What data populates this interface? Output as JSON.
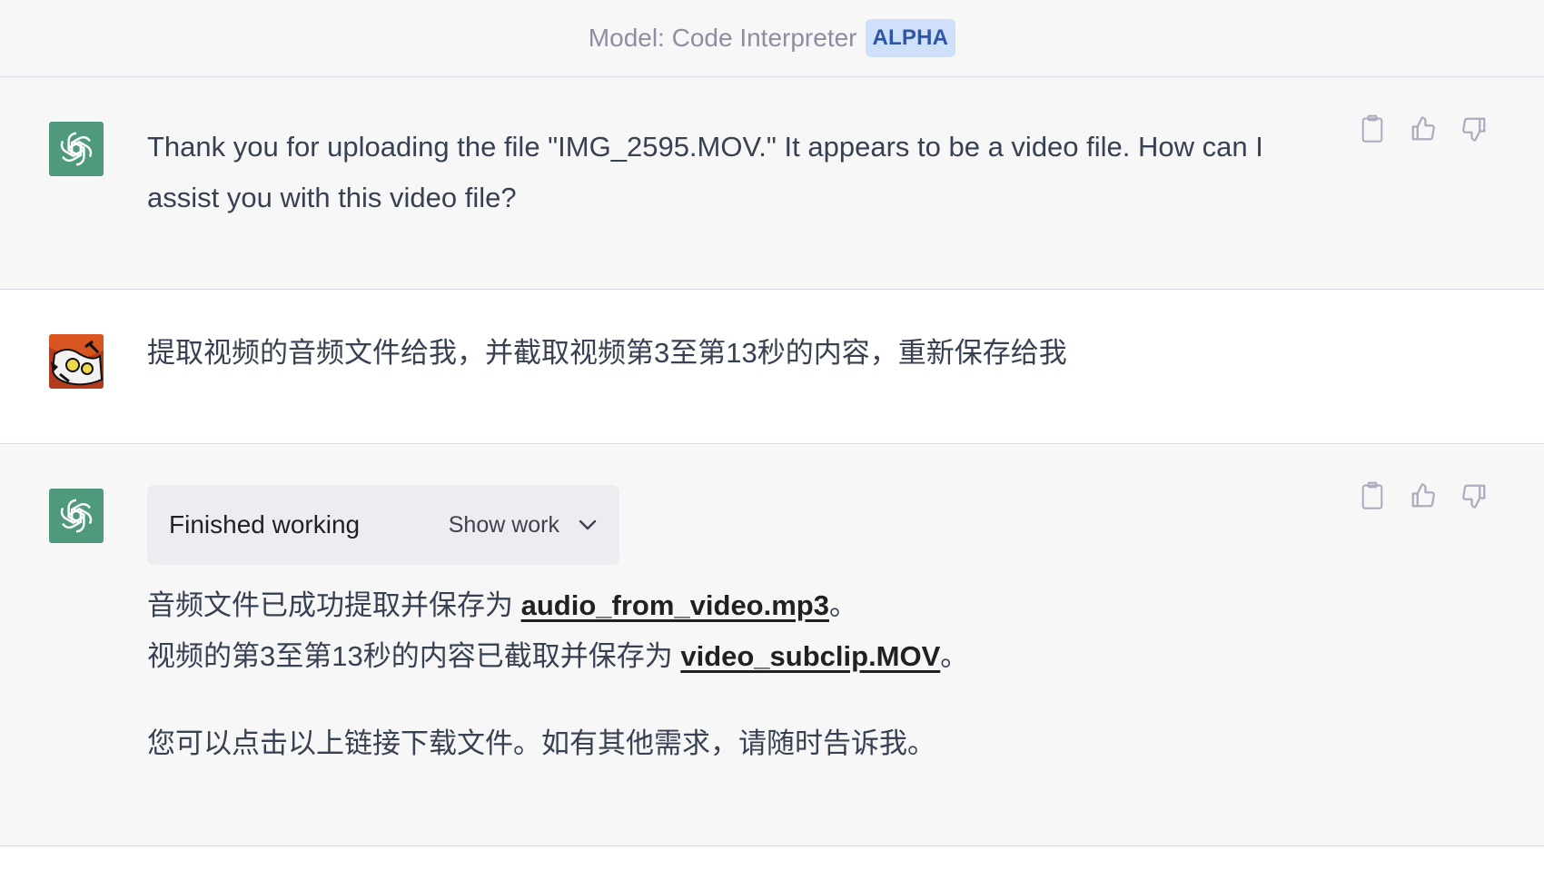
{
  "header": {
    "model_label": "Model: Code Interpreter",
    "badge": "ALPHA"
  },
  "messages": {
    "assistant_1": {
      "text": "Thank you for uploading the file \"IMG_2595.MOV.\" It appears to be a video file. How can I assist you with this video file?"
    },
    "user_1": {
      "text": "提取视频的音频文件给我，并截取视频第3至第13秒的内容，重新保存给我"
    },
    "assistant_2": {
      "status": "Finished working",
      "show_work": "Show work",
      "line1_prefix": "音频文件已成功提取并保存为 ",
      "link1": "audio_from_video.mp3",
      "line1_suffix": "。",
      "line2_prefix": "视频的第3至第13秒的内容已截取并保存为 ",
      "link2": "video_subclip.MOV",
      "line2_suffix": "。",
      "line3": "您可以点击以上链接下载文件。如有其他需求，请随时告诉我。"
    }
  },
  "icons": {
    "copy": "clipboard-icon",
    "like": "thumbs-up-icon",
    "dislike": "thumbs-down-icon",
    "expand": "chevron-down-icon"
  },
  "colors": {
    "gpt_avatar": "#4f9a7d",
    "badge_bg": "#cfe1fa",
    "badge_text": "#2f56a6"
  }
}
